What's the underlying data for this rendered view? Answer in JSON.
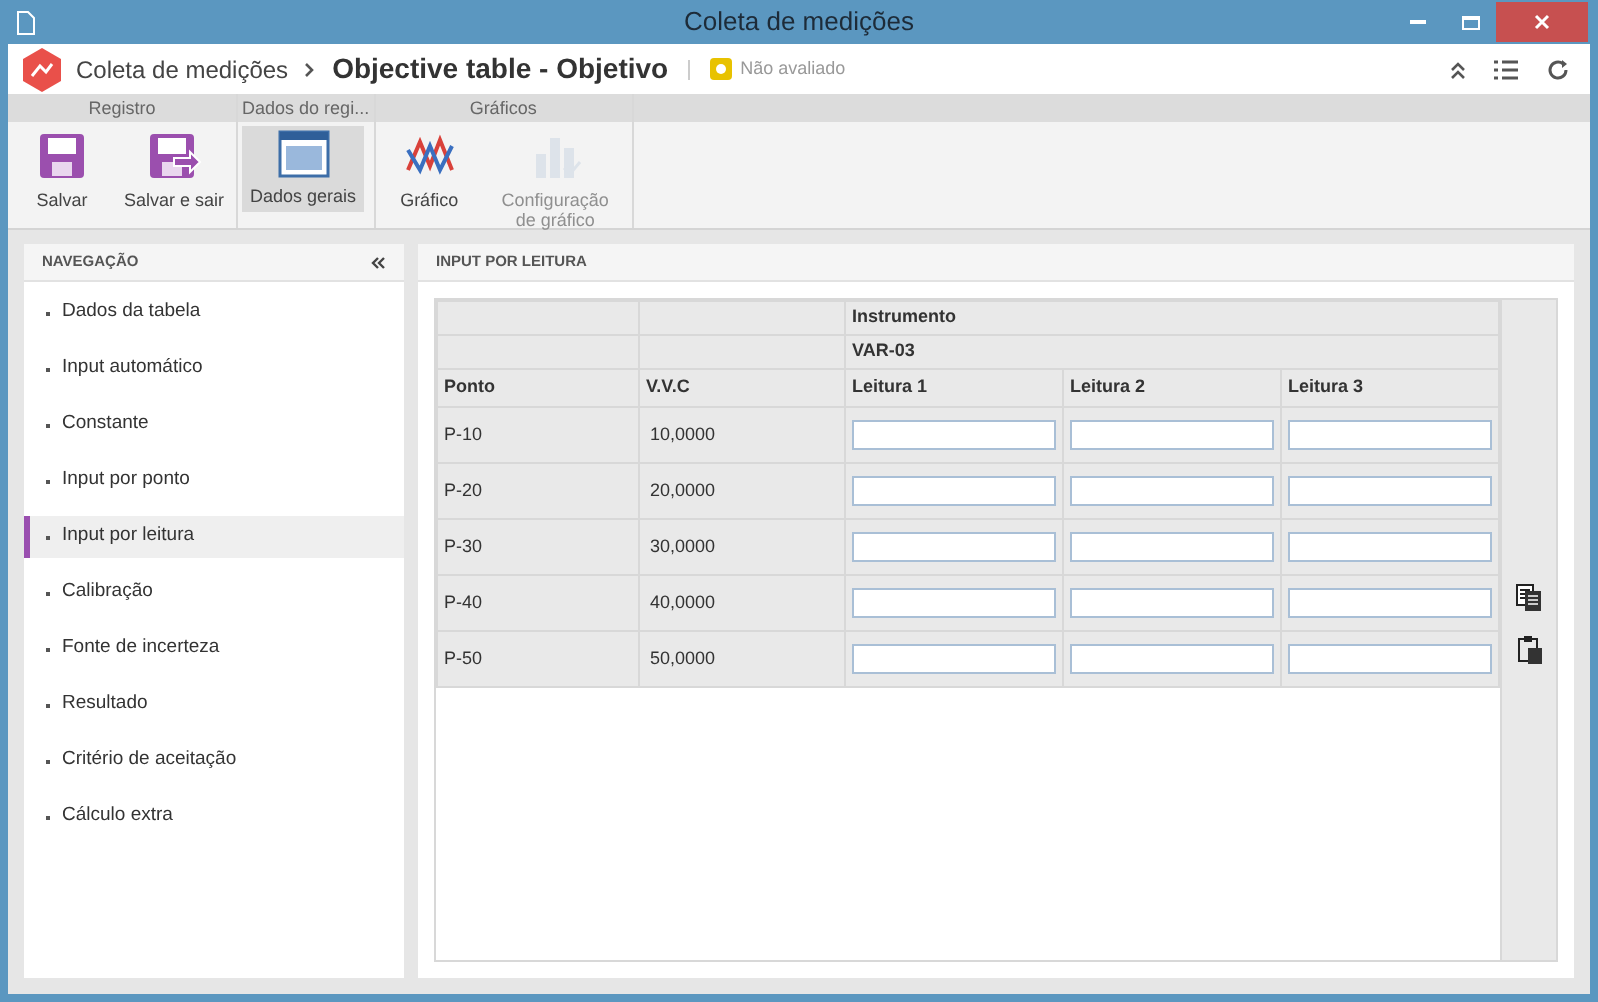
{
  "window": {
    "title": "Coleta de medições"
  },
  "header": {
    "breadcrumb": "Coleta de medições",
    "title": "Objective table - Objetivo",
    "status": {
      "label": "Não avaliado",
      "color": "#e8c200"
    }
  },
  "ribbon": {
    "groups": [
      {
        "label": "Registro",
        "buttons": [
          {
            "label": "Salvar",
            "kind": "save",
            "selected": false,
            "disabled": false
          },
          {
            "label": "Salvar e sair",
            "kind": "save-exit",
            "selected": false,
            "disabled": false
          }
        ]
      },
      {
        "label": "Dados do regi...",
        "buttons": [
          {
            "label": "Dados gerais",
            "kind": "window",
            "selected": true,
            "disabled": false
          }
        ]
      },
      {
        "label": "Gráficos",
        "buttons": [
          {
            "label": "Gráfico",
            "kind": "line",
            "selected": false,
            "disabled": false
          },
          {
            "label": "Configuração de gráfico",
            "kind": "bars",
            "selected": false,
            "disabled": true
          }
        ]
      }
    ]
  },
  "sidebar": {
    "title": "NAVEGAÇÃO",
    "items": [
      {
        "label": "Dados da tabela",
        "selected": false
      },
      {
        "label": "Input automático",
        "selected": false
      },
      {
        "label": "Constante",
        "selected": false
      },
      {
        "label": "Input por ponto",
        "selected": false
      },
      {
        "label": "Input por leitura",
        "selected": true
      },
      {
        "label": "Calibração",
        "selected": false
      },
      {
        "label": "Fonte de incerteza",
        "selected": false
      },
      {
        "label": "Resultado",
        "selected": false
      },
      {
        "label": "Critério de aceitação",
        "selected": false
      },
      {
        "label": "Cálculo extra",
        "selected": false
      }
    ]
  },
  "panel": {
    "title": "INPUT POR LEITURA",
    "table": {
      "group_header": "Instrumento",
      "instrument": "VAR-03",
      "columns": [
        "Ponto",
        "V.V.C",
        "Leitura 1",
        "Leitura 2",
        "Leitura 3"
      ],
      "rows": [
        {
          "ponto": "P-10",
          "vvc": "10,0000"
        },
        {
          "ponto": "P-20",
          "vvc": "20,0000"
        },
        {
          "ponto": "P-30",
          "vvc": "30,0000"
        },
        {
          "ponto": "P-40",
          "vvc": "40,0000"
        },
        {
          "ponto": "P-50",
          "vvc": "50,0000"
        }
      ]
    }
  }
}
